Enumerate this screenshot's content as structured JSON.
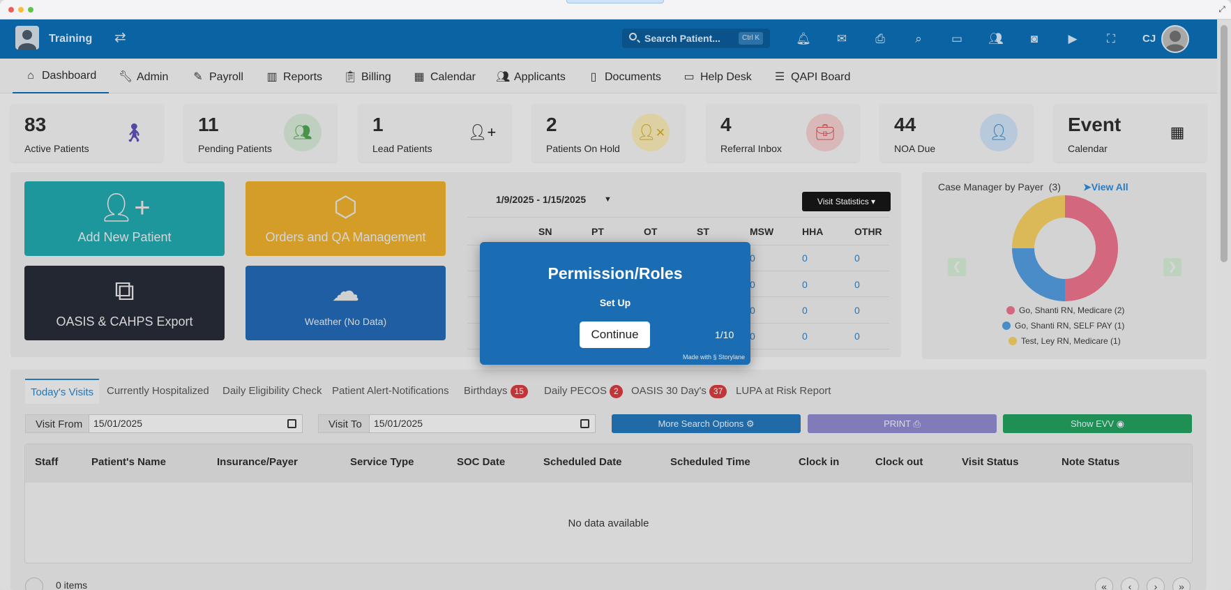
{
  "app": {
    "brand": "Training",
    "initials": "CJ"
  },
  "search": {
    "placeholder": "Search Patient...",
    "shortcut": "Ctrl K"
  },
  "nav": [
    {
      "label": "Dashboard",
      "icon": "home-icon"
    },
    {
      "label": "Admin",
      "icon": "wrench-icon"
    },
    {
      "label": "Payroll",
      "icon": "edit-icon"
    },
    {
      "label": "Reports",
      "icon": "bar-chart-icon"
    },
    {
      "label": "Billing",
      "icon": "clipboard-icon"
    },
    {
      "label": "Calendar",
      "icon": "calendar-icon"
    },
    {
      "label": "Applicants",
      "icon": "users-icon"
    },
    {
      "label": "Documents",
      "icon": "document-icon"
    },
    {
      "label": "Help Desk",
      "icon": "ticket-icon"
    },
    {
      "label": "QAPI Board",
      "icon": "clipboard-list-icon"
    }
  ],
  "stats": [
    {
      "value": "83",
      "label": "Active Patients"
    },
    {
      "value": "11",
      "label": "Pending Patients"
    },
    {
      "value": "1",
      "label": "Lead Patients"
    },
    {
      "value": "2",
      "label": "Patients On Hold"
    },
    {
      "value": "4",
      "label": "Referral Inbox"
    },
    {
      "value": "44",
      "label": "NOA Due"
    },
    {
      "value": "Event",
      "label": "Calendar"
    }
  ],
  "tiles": {
    "add_patient": "Add New Patient",
    "orders": "Orders and QA Management",
    "oasis": "OASIS & CAHPS Export",
    "weather": "Weather (No Data)"
  },
  "visit_stats": {
    "date_range": "1/9/2025 - 1/15/2025",
    "button": "Visit Statistics",
    "columns": [
      "SN",
      "PT",
      "OT",
      "ST",
      "MSW",
      "HHA",
      "OTHR"
    ],
    "rows": [
      [
        "0",
        "0",
        "0"
      ],
      [
        "0",
        "0",
        "0"
      ],
      [
        "0",
        "0",
        "0"
      ],
      [
        "0",
        "0",
        "0"
      ]
    ]
  },
  "payer": {
    "title": "Case Manager by Payer",
    "count": "(3)",
    "view_all": "View All",
    "legend": [
      {
        "label": "Go, Shanti RN, Medicare (2)",
        "color": "#e46f88"
      },
      {
        "label": "Go, Shanti RN, SELF PAY  (1)",
        "color": "#4f97d8"
      },
      {
        "label": "Test, Ley RN, Medicare (1)",
        "color": "#ecc65f"
      }
    ]
  },
  "chart_data": {
    "type": "pie",
    "categories": [
      "Go, Shanti RN, Medicare",
      "Go, Shanti RN, SELF PAY",
      "Test, Ley RN, Medicare"
    ],
    "values": [
      2,
      1,
      1
    ],
    "colors": [
      "#e46f88",
      "#4f97d8",
      "#ecc65f"
    ]
  },
  "tabs": [
    {
      "label": "Today's Visits",
      "badge": ""
    },
    {
      "label": "Currently Hospitalized",
      "badge": ""
    },
    {
      "label": "Daily Eligibility Check",
      "badge": ""
    },
    {
      "label": "Patient Alert-Notifications",
      "badge": ""
    },
    {
      "label": "Birthdays",
      "badge": "15"
    },
    {
      "label": "Daily PECOS",
      "badge": "2"
    },
    {
      "label": "OASIS 30 Day's",
      "badge": "37"
    },
    {
      "label": "LUPA at Risk Report",
      "badge": ""
    }
  ],
  "filters": {
    "visit_from_label": "Visit From",
    "visit_from": "15/01/2025",
    "visit_to_label": "Visit To",
    "visit_to": "15/01/2025",
    "more_options": "More Search Options ⚙",
    "print": "PRINT ⎙",
    "show_evv": "Show EVV ◉"
  },
  "table": {
    "columns": [
      "Staff",
      "Patient's Name",
      "Insurance/Payer",
      "Service Type",
      "SOC Date",
      "Scheduled Date",
      "Scheduled Time",
      "Clock in",
      "Clock out",
      "Visit Status",
      "Note Status"
    ],
    "empty": "No data available",
    "items": "0 items"
  },
  "modal": {
    "title": "Permission/Roles",
    "subtitle": "Set Up",
    "button": "Continue",
    "counter": "1/10",
    "made_with": "Made with § Storylane"
  }
}
